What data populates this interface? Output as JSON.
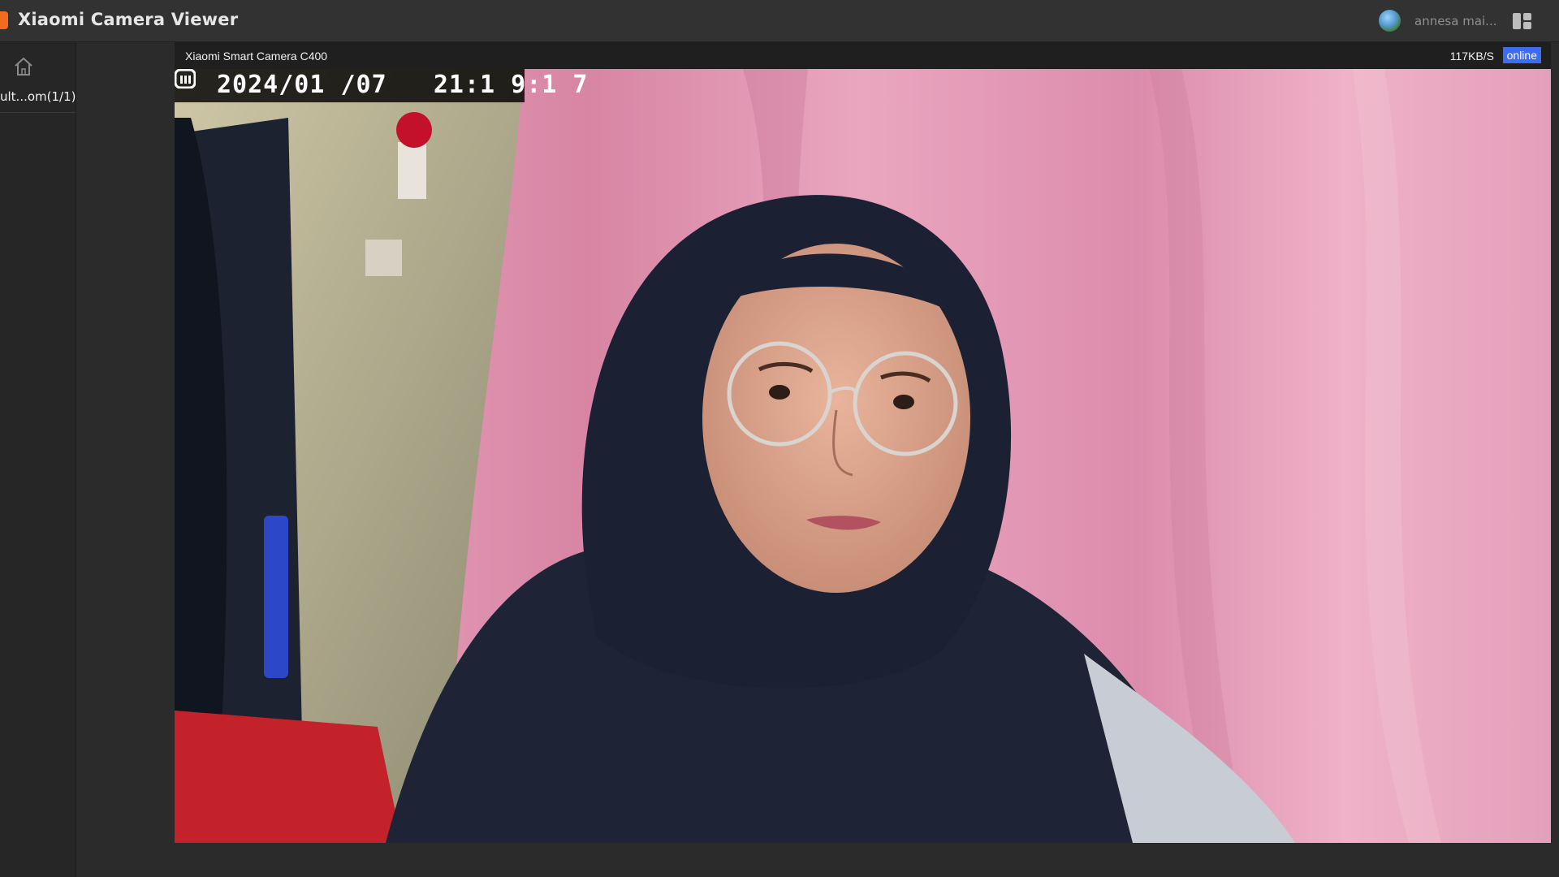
{
  "app": {
    "title": "Xiaomi Camera Viewer",
    "user_name": "annesa mai..."
  },
  "sidebar": {
    "device_label": "ult...om(1/1)"
  },
  "camera": {
    "name": "Xiaomi Smart Camera C400",
    "bitrate": "117KB/S",
    "status": "online",
    "osd_timestamp": "2024/01 /07   21:1 9:1 7",
    "status_color": "#3d6cf0"
  },
  "icons": {
    "home": "home-icon",
    "layout": "grid-layout-icon",
    "logo": "mi-logo-icon"
  }
}
